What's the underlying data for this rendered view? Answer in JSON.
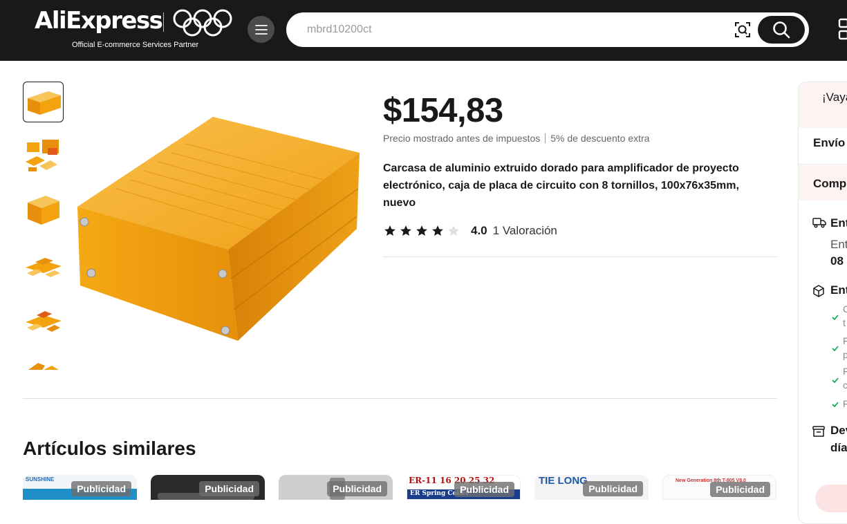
{
  "header": {
    "logo": "AliExpress",
    "partner_text": "Official E-commerce Services Partner",
    "menu_icon": "hamburger-menu-icon",
    "search": {
      "placeholder": "mbrd10200ct"
    },
    "camera_icon": "image-search-icon",
    "search_icon": "search-icon",
    "grid_icon": "app-grid-icon"
  },
  "gallery": {
    "thumbnails_count": 6,
    "active_index": 0
  },
  "product": {
    "price": "$154,83",
    "price_note": "Precio mostrado antes de impuestos",
    "discount_note": "5% de descuento extra",
    "title": "Carcasa de aluminio extruido dorado para amplificador de proyecto electrónico, caja de placa de circuito con 8 tornillos, 100x76x35mm, nuevo",
    "rating_value": "4.0",
    "rating_count": "1 Valoración",
    "stars_filled": 4,
    "stars_total": 5
  },
  "similar": {
    "heading": "Artículos similares",
    "ad_label": "Publicidad",
    "cards": [
      {
        "brand_text": "SUNSHINE"
      },
      {
        "brand_text": ""
      },
      {
        "brand_text": ""
      },
      {
        "brand_text": "ER-11 16 20 25 32",
        "sub_text": "ER Spring Collet"
      },
      {
        "brand_text": "TIE LONG"
      },
      {
        "brand_text": "New Generation 8th T-805 V8.0"
      }
    ]
  },
  "right_panel": {
    "top_text": "¡Vaya",
    "shipping": "Envío",
    "compare": "Comp",
    "delivery_heading": "Ent",
    "delivery_line": "Ent",
    "delivery_date": "08",
    "protection_heading": "Ent",
    "returns_heading": "Dev",
    "returns_line": "día",
    "check_items": [
      "C",
      "t",
      "F",
      "p",
      "F",
      "c",
      "F"
    ]
  },
  "colors": {
    "header_bg": "#191919",
    "product_gold": "#f2a30f",
    "star": "#191919",
    "star_empty": "#e0e0e0",
    "check_green": "#00a650"
  }
}
